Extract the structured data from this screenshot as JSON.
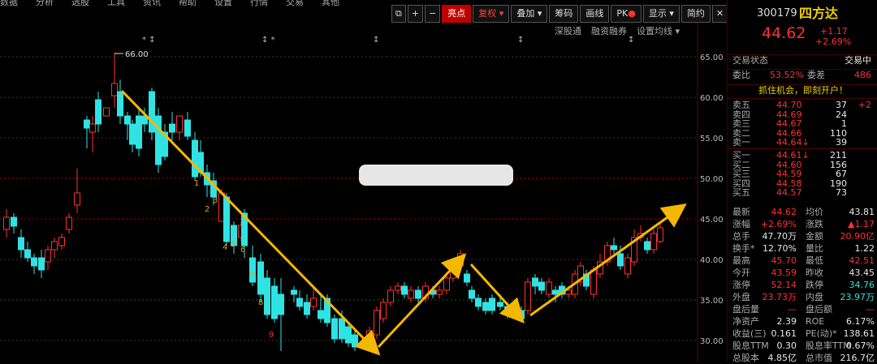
{
  "top_menu": [
    "数据",
    "分析",
    "选股",
    "工具",
    "资讯",
    "帮助",
    "设置",
    "行情",
    "交易",
    "其他"
  ],
  "toolbar": {
    "restore_icon": "restore-icon",
    "zoom_in": "+",
    "zoom_out": "−",
    "highlight": "亮点",
    "adjust": "复权",
    "overlay": "叠加",
    "chip": "筹码",
    "draw": "画线",
    "pk": "PK",
    "display": "显示",
    "simple": "简约"
  },
  "subbar": [
    "深股通",
    "融资融券",
    "设置均线"
  ],
  "chart": {
    "y_ticks": [
      "65.00",
      "60.00",
      "55.00",
      "50.00",
      "45.00",
      "40.00",
      "35.00",
      "30.00"
    ],
    "high_label": "66.00",
    "wave_labels": [
      "1",
      "2",
      "3",
      "4",
      "5",
      "6",
      "7",
      "8",
      "9"
    ],
    "colors": {
      "up": "#ff3030",
      "down": "#2fe3e3",
      "arrow": "#f5b800",
      "grid_red": "#aa0000",
      "grid_grn": "#006600"
    }
  },
  "quote": {
    "code": "300179",
    "name": "四方达",
    "price": "44.62",
    "change": "+1.17",
    "pct": "+2.69%",
    "status_label": "交易状态",
    "status": "交易中",
    "webi_label": "委比",
    "webi": "53.52%",
    "weicha_label": "委差",
    "weicha": "486",
    "banner": "抓住机会，即刻开户！",
    "asks": [
      {
        "label": "卖五",
        "price": "44.70",
        "vol": "37",
        "extra": "+2"
      },
      {
        "label": "卖四",
        "price": "44.69",
        "vol": "24",
        "extra": ""
      },
      {
        "label": "卖三",
        "price": "44.67",
        "vol": "1",
        "extra": ""
      },
      {
        "label": "卖二",
        "price": "44.66",
        "vol": "110",
        "extra": ""
      },
      {
        "label": "卖一",
        "price": "44.64↓",
        "vol": "39",
        "extra": ""
      }
    ],
    "bids": [
      {
        "label": "买一",
        "price": "44.61↓",
        "vol": "211",
        "extra": ""
      },
      {
        "label": "买二",
        "price": "44.60",
        "vol": "156",
        "extra": ""
      },
      {
        "label": "买三",
        "price": "44.59",
        "vol": "67",
        "extra": ""
      },
      {
        "label": "买四",
        "price": "44.58",
        "vol": "190",
        "extra": ""
      },
      {
        "label": "买五",
        "price": "44.57",
        "vol": "73",
        "extra": ""
      }
    ],
    "stats": [
      {
        "l1": "最新",
        "v1": "44.62",
        "l2": "均价",
        "v2": "43.81"
      },
      {
        "l1": "涨幅",
        "v1": "+2.69%",
        "l2": "涨跌",
        "v2": "▲1.17"
      },
      {
        "l1": "总手",
        "v1": "47.70万",
        "l2": "金额",
        "v2": "20.90亿"
      },
      {
        "l1": "换手*",
        "v1": "12.70%",
        "l2": "量比",
        "v2": "1.22"
      },
      {
        "l1": "最高",
        "v1": "45.70",
        "l2": "最低",
        "v2": "42.51"
      },
      {
        "l1": "今开",
        "v1": "43.59",
        "l2": "昨收",
        "v2": "43.45"
      },
      {
        "l1": "涨停",
        "v1": "52.14",
        "l2": "跌停",
        "v2": "34.76"
      },
      {
        "l1": "外盘",
        "v1": "23.73万",
        "l2": "内盘",
        "v2": "23.97万"
      },
      {
        "l1": "盘后量",
        "v1": "—",
        "l2": "盘后额",
        "v2": "—"
      },
      {
        "l1": "净资产",
        "v1": "2.39",
        "l2": "ROE",
        "v2": "6.17%"
      },
      {
        "l1": "收益(三)",
        "v1": "0.161",
        "l2": "PE(动)*",
        "v2": "138.61"
      },
      {
        "l1": "股息TTM",
        "v1": "0.30",
        "l2": "股息率TTM",
        "v2": "0.67%"
      },
      {
        "l1": "总股本",
        "v1": "4.85亿",
        "l2": "总市值",
        "v2": "216.7亿"
      }
    ]
  }
}
